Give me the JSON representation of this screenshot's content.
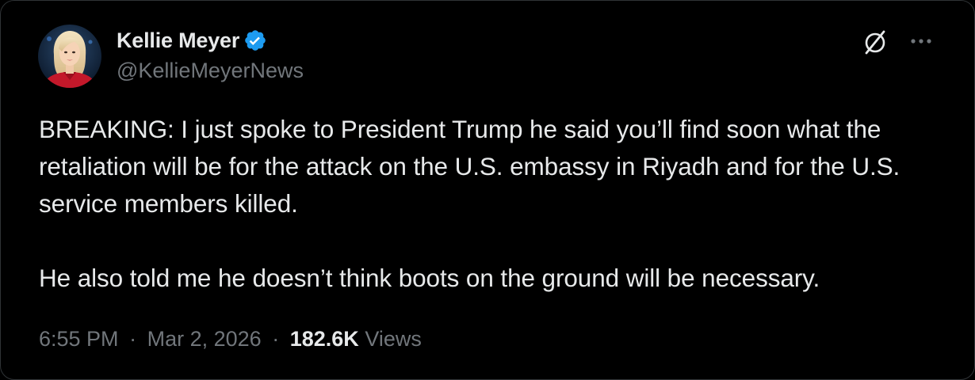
{
  "author": {
    "display_name": "Kellie Meyer",
    "handle": "@KellieMeyerNews",
    "verified": true,
    "verified_color": "#1d9bf0"
  },
  "tweet": {
    "paragraphs": [
      "BREAKING: I just spoke to President Trump he said you’ll find soon what the retaliation will be for the attack on the U.S. embassy in Riyadh and for the U.S. service members killed.",
      "He also told me he doesn’t think boots on the ground will be necessary."
    ]
  },
  "meta": {
    "time": "6:55 PM",
    "separator": "·",
    "date": "Mar 2, 2026",
    "views_count": "182.6K",
    "views_label": "Views"
  },
  "icons": {
    "avatar": "profile-photo",
    "verified": "verified-badge-icon",
    "grok": "grok-icon",
    "more": "more-options-icon"
  },
  "colors": {
    "background": "#000000",
    "text": "#e7e9ea",
    "secondary_text": "#71767b",
    "border": "#2f3336"
  }
}
